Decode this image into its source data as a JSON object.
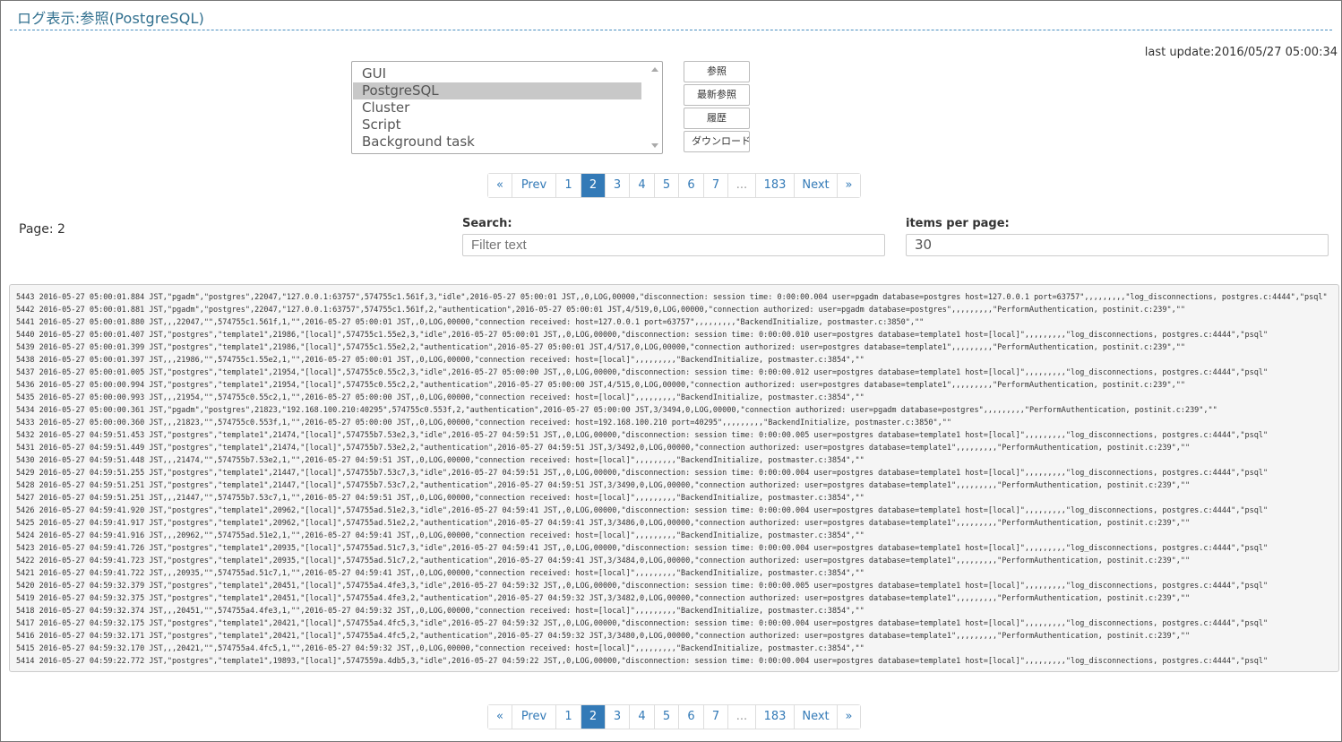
{
  "header": {
    "title": "ログ表示:参照(PostgreSQL)",
    "last_update": "last update:2016/05/27 05:00:34"
  },
  "log_type_list": {
    "options": [
      "GUI",
      "PostgreSQL",
      "Cluster",
      "Script",
      "Background task"
    ],
    "selected": "PostgreSQL"
  },
  "actions": {
    "view": "参照",
    "latest": "最新参照",
    "history": "履歴",
    "download": "ダウンロード"
  },
  "pagination": {
    "items": [
      "«",
      "Prev",
      "1",
      "2",
      "3",
      "4",
      "5",
      "6",
      "7",
      "...",
      "183",
      "Next",
      "»"
    ],
    "current": "2"
  },
  "page_info": {
    "page_label": "Page: 2"
  },
  "search": {
    "label": "Search:",
    "placeholder": "Filter text",
    "value": ""
  },
  "items_per_page": {
    "label": "items per page:",
    "value": "30"
  },
  "log_lines": [
    "5443 2016-05-27 05:00:01.884 JST,\"pgadm\",\"postgres\",22047,\"127.0.0.1:63757\",574755c1.561f,3,\"idle\",2016-05-27 05:00:01 JST,,0,LOG,00000,\"disconnection: session time: 0:00:00.004 user=pgadm database=postgres host=127.0.0.1 port=63757\",,,,,,,,,\"log_disconnections, postgres.c:4444\",\"psql\"",
    "5442 2016-05-27 05:00:01.881 JST,\"pgadm\",\"postgres\",22047,\"127.0.0.1:63757\",574755c1.561f,2,\"authentication\",2016-05-27 05:00:01 JST,4/519,0,LOG,00000,\"connection authorized: user=pgadm database=postgres\",,,,,,,,,\"PerformAuthentication, postinit.c:239\",\"\"",
    "5441 2016-05-27 05:00:01.880 JST,,,22047,\"\",574755c1.561f,1,\"\",2016-05-27 05:00:01 JST,,0,LOG,00000,\"connection received: host=127.0.0.1 port=63757\",,,,,,,,,\"BackendInitialize, postmaster.c:3850\",\"\"",
    "5440 2016-05-27 05:00:01.407 JST,\"postgres\",\"template1\",21986,\"[local]\",574755c1.55e2,3,\"idle\",2016-05-27 05:00:01 JST,,0,LOG,00000,\"disconnection: session time: 0:00:00.010 user=postgres database=template1 host=[local]\",,,,,,,,,\"log_disconnections, postgres.c:4444\",\"psql\"",
    "5439 2016-05-27 05:00:01.399 JST,\"postgres\",\"template1\",21986,\"[local]\",574755c1.55e2,2,\"authentication\",2016-05-27 05:00:01 JST,4/517,0,LOG,00000,\"connection authorized: user=postgres database=template1\",,,,,,,,,\"PerformAuthentication, postinit.c:239\",\"\"",
    "5438 2016-05-27 05:00:01.397 JST,,,21986,\"\",574755c1.55e2,1,\"\",2016-05-27 05:00:01 JST,,0,LOG,00000,\"connection received: host=[local]\",,,,,,,,,\"BackendInitialize, postmaster.c:3854\",\"\"",
    "5437 2016-05-27 05:00:01.005 JST,\"postgres\",\"template1\",21954,\"[local]\",574755c0.55c2,3,\"idle\",2016-05-27 05:00:00 JST,,0,LOG,00000,\"disconnection: session time: 0:00:00.012 user=postgres database=template1 host=[local]\",,,,,,,,,\"log_disconnections, postgres.c:4444\",\"psql\"",
    "5436 2016-05-27 05:00:00.994 JST,\"postgres\",\"template1\",21954,\"[local]\",574755c0.55c2,2,\"authentication\",2016-05-27 05:00:00 JST,4/515,0,LOG,00000,\"connection authorized: user=postgres database=template1\",,,,,,,,,\"PerformAuthentication, postinit.c:239\",\"\"",
    "5435 2016-05-27 05:00:00.993 JST,,,21954,\"\",574755c0.55c2,1,\"\",2016-05-27 05:00:00 JST,,0,LOG,00000,\"connection received: host=[local]\",,,,,,,,,\"BackendInitialize, postmaster.c:3854\",\"\"",
    "5434 2016-05-27 05:00:00.361 JST,\"pgadm\",\"postgres\",21823,\"192.168.100.210:40295\",574755c0.553f,2,\"authentication\",2016-05-27 05:00:00 JST,3/3494,0,LOG,00000,\"connection authorized: user=pgadm database=postgres\",,,,,,,,,\"PerformAuthentication, postinit.c:239\",\"\"",
    "5433 2016-05-27 05:00:00.360 JST,,,21823,\"\",574755c0.553f,1,\"\",2016-05-27 05:00:00 JST,,0,LOG,00000,\"connection received: host=192.168.100.210 port=40295\",,,,,,,,,\"BackendInitialize, postmaster.c:3850\",\"\"",
    "5432 2016-05-27 04:59:51.453 JST,\"postgres\",\"template1\",21474,\"[local]\",574755b7.53e2,3,\"idle\",2016-05-27 04:59:51 JST,,0,LOG,00000,\"disconnection: session time: 0:00:00.005 user=postgres database=template1 host=[local]\",,,,,,,,,\"log_disconnections, postgres.c:4444\",\"psql\"",
    "5431 2016-05-27 04:59:51.449 JST,\"postgres\",\"template1\",21474,\"[local]\",574755b7.53e2,2,\"authentication\",2016-05-27 04:59:51 JST,3/3492,0,LOG,00000,\"connection authorized: user=postgres database=template1\",,,,,,,,,\"PerformAuthentication, postinit.c:239\",\"\"",
    "5430 2016-05-27 04:59:51.448 JST,,,21474,\"\",574755b7.53e2,1,\"\",2016-05-27 04:59:51 JST,,0,LOG,00000,\"connection received: host=[local]\",,,,,,,,,\"BackendInitialize, postmaster.c:3854\",\"\"",
    "5429 2016-05-27 04:59:51.255 JST,\"postgres\",\"template1\",21447,\"[local]\",574755b7.53c7,3,\"idle\",2016-05-27 04:59:51 JST,,0,LOG,00000,\"disconnection: session time: 0:00:00.004 user=postgres database=template1 host=[local]\",,,,,,,,,\"log_disconnections, postgres.c:4444\",\"psql\"",
    "5428 2016-05-27 04:59:51.251 JST,\"postgres\",\"template1\",21447,\"[local]\",574755b7.53c7,2,\"authentication\",2016-05-27 04:59:51 JST,3/3490,0,LOG,00000,\"connection authorized: user=postgres database=template1\",,,,,,,,,\"PerformAuthentication, postinit.c:239\",\"\"",
    "5427 2016-05-27 04:59:51.251 JST,,,21447,\"\",574755b7.53c7,1,\"\",2016-05-27 04:59:51 JST,,0,LOG,00000,\"connection received: host=[local]\",,,,,,,,,\"BackendInitialize, postmaster.c:3854\",\"\"",
    "5426 2016-05-27 04:59:41.920 JST,\"postgres\",\"template1\",20962,\"[local]\",574755ad.51e2,3,\"idle\",2016-05-27 04:59:41 JST,,0,LOG,00000,\"disconnection: session time: 0:00:00.004 user=postgres database=template1 host=[local]\",,,,,,,,,\"log_disconnections, postgres.c:4444\",\"psql\"",
    "5425 2016-05-27 04:59:41.917 JST,\"postgres\",\"template1\",20962,\"[local]\",574755ad.51e2,2,\"authentication\",2016-05-27 04:59:41 JST,3/3486,0,LOG,00000,\"connection authorized: user=postgres database=template1\",,,,,,,,,\"PerformAuthentication, postinit.c:239\",\"\"",
    "5424 2016-05-27 04:59:41.916 JST,,,20962,\"\",574755ad.51e2,1,\"\",2016-05-27 04:59:41 JST,,0,LOG,00000,\"connection received: host=[local]\",,,,,,,,,\"BackendInitialize, postmaster.c:3854\",\"\"",
    "5423 2016-05-27 04:59:41.726 JST,\"postgres\",\"template1\",20935,\"[local]\",574755ad.51c7,3,\"idle\",2016-05-27 04:59:41 JST,,0,LOG,00000,\"disconnection: session time: 0:00:00.004 user=postgres database=template1 host=[local]\",,,,,,,,,\"log_disconnections, postgres.c:4444\",\"psql\"",
    "5422 2016-05-27 04:59:41.723 JST,\"postgres\",\"template1\",20935,\"[local]\",574755ad.51c7,2,\"authentication\",2016-05-27 04:59:41 JST,3/3484,0,LOG,00000,\"connection authorized: user=postgres database=template1\",,,,,,,,,\"PerformAuthentication, postinit.c:239\",\"\"",
    "5421 2016-05-27 04:59:41.722 JST,,,20935,\"\",574755ad.51c7,1,\"\",2016-05-27 04:59:41 JST,,0,LOG,00000,\"connection received: host=[local]\",,,,,,,,,\"BackendInitialize, postmaster.c:3854\",\"\"",
    "5420 2016-05-27 04:59:32.379 JST,\"postgres\",\"template1\",20451,\"[local]\",574755a4.4fe3,3,\"idle\",2016-05-27 04:59:32 JST,,0,LOG,00000,\"disconnection: session time: 0:00:00.005 user=postgres database=template1 host=[local]\",,,,,,,,,\"log_disconnections, postgres.c:4444\",\"psql\"",
    "5419 2016-05-27 04:59:32.375 JST,\"postgres\",\"template1\",20451,\"[local]\",574755a4.4fe3,2,\"authentication\",2016-05-27 04:59:32 JST,3/3482,0,LOG,00000,\"connection authorized: user=postgres database=template1\",,,,,,,,,\"PerformAuthentication, postinit.c:239\",\"\"",
    "5418 2016-05-27 04:59:32.374 JST,,,20451,\"\",574755a4.4fe3,1,\"\",2016-05-27 04:59:32 JST,,0,LOG,00000,\"connection received: host=[local]\",,,,,,,,,\"BackendInitialize, postmaster.c:3854\",\"\"",
    "5417 2016-05-27 04:59:32.175 JST,\"postgres\",\"template1\",20421,\"[local]\",574755a4.4fc5,3,\"idle\",2016-05-27 04:59:32 JST,,0,LOG,00000,\"disconnection: session time: 0:00:00.004 user=postgres database=template1 host=[local]\",,,,,,,,,\"log_disconnections, postgres.c:4444\",\"psql\"",
    "5416 2016-05-27 04:59:32.171 JST,\"postgres\",\"template1\",20421,\"[local]\",574755a4.4fc5,2,\"authentication\",2016-05-27 04:59:32 JST,3/3480,0,LOG,00000,\"connection authorized: user=postgres database=template1\",,,,,,,,,\"PerformAuthentication, postinit.c:239\",\"\"",
    "5415 2016-05-27 04:59:32.170 JST,,,20421,\"\",574755a4.4fc5,1,\"\",2016-05-27 04:59:32 JST,,0,LOG,00000,\"connection received: host=[local]\",,,,,,,,,\"BackendInitialize, postmaster.c:3854\",\"\"",
    "5414 2016-05-27 04:59:22.772 JST,\"postgres\",\"template1\",19893,\"[local]\",5747559a.4db5,3,\"idle\",2016-05-27 04:59:22 JST,,0,LOG,00000,\"disconnection: session time: 0:00:00.004 user=postgres database=template1 host=[local]\",,,,,,,,,\"log_disconnections, postgres.c:4444\",\"psql\""
  ]
}
